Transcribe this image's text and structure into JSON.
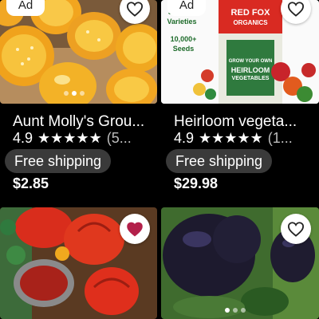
{
  "listings": [
    {
      "ad_label": "Ad",
      "title": "Aunt Molly's Grou...",
      "rating": "4.9",
      "stars": "★★★★★",
      "review_count": "(5...",
      "shipping": "Free shipping",
      "price": "$2.85",
      "favorited": false
    },
    {
      "ad_label": "Ad",
      "title": "Heirloom vegeta...",
      "rating": "4.9",
      "stars": "★★★★★",
      "review_count": "(1...",
      "shipping": "Free shipping",
      "price": "$29.98",
      "favorited": false,
      "image_text": {
        "varieties": "35 Seed Varieties",
        "seeds": "10,000+ Seeds",
        "brand_line1": "RED FOX",
        "brand_line2": "ORGANICS",
        "grow": "GROW YOUR OWN",
        "heirloom": "HEIRLOOM",
        "vegetables": "VEGETABLES"
      }
    },
    {
      "favorited": true
    },
    {
      "favorited": false
    }
  ],
  "colors": {
    "background": "#000000",
    "pill": "#3a3a3a",
    "heart_filled": "#b3204a",
    "heart_outline": "#222222"
  }
}
